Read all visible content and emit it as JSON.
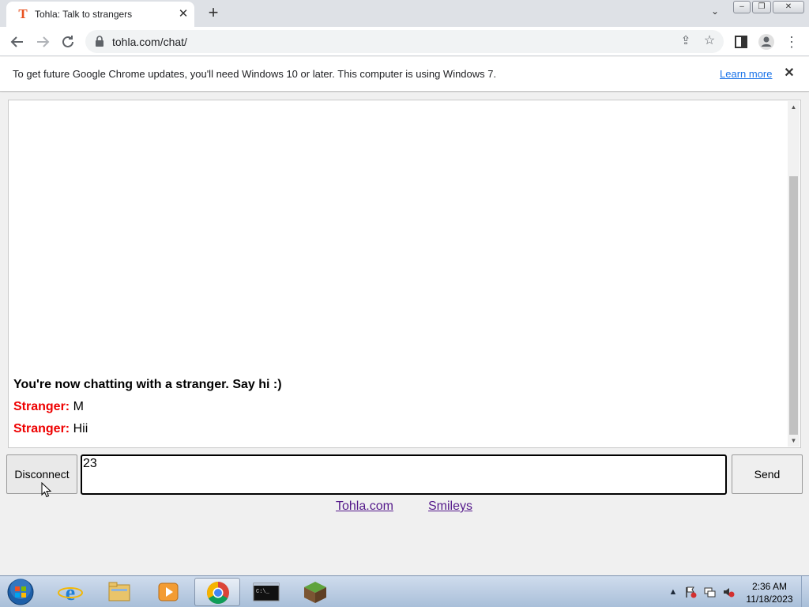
{
  "browser": {
    "tab": {
      "title": "Tohla: Talk to strangers",
      "favicon_letter": "T"
    },
    "window_controls": {
      "minimize": "–",
      "maximize": "❐",
      "close": "✕"
    },
    "url": "tohla.com/chat/",
    "infobar": {
      "message": "To get future Google Chrome updates, you'll need Windows 10 or later. This computer is using Windows 7.",
      "link": "Learn more"
    }
  },
  "chat": {
    "system_message": "You're now chatting with a stranger. Say hi :)",
    "messages": [
      {
        "sender": "Stranger:",
        "text": "M"
      },
      {
        "sender": "Stranger:",
        "text": "Hii"
      }
    ],
    "input_value": "23",
    "disconnect_label": "Disconnect",
    "send_label": "Send"
  },
  "footer_links": {
    "home": "Tohla.com",
    "smileys": "Smileys"
  },
  "taskbar": {
    "apps": [
      "internet-explorer",
      "windows-explorer",
      "media-player",
      "google-chrome",
      "command-prompt",
      "minecraft"
    ],
    "active_app": "google-chrome",
    "clock": {
      "time": "2:36 AM",
      "date": "11/18/2023"
    }
  },
  "colors": {
    "stranger_label": "#ee0000",
    "link": "#551a8b",
    "infobar_link": "#1a73e8"
  }
}
